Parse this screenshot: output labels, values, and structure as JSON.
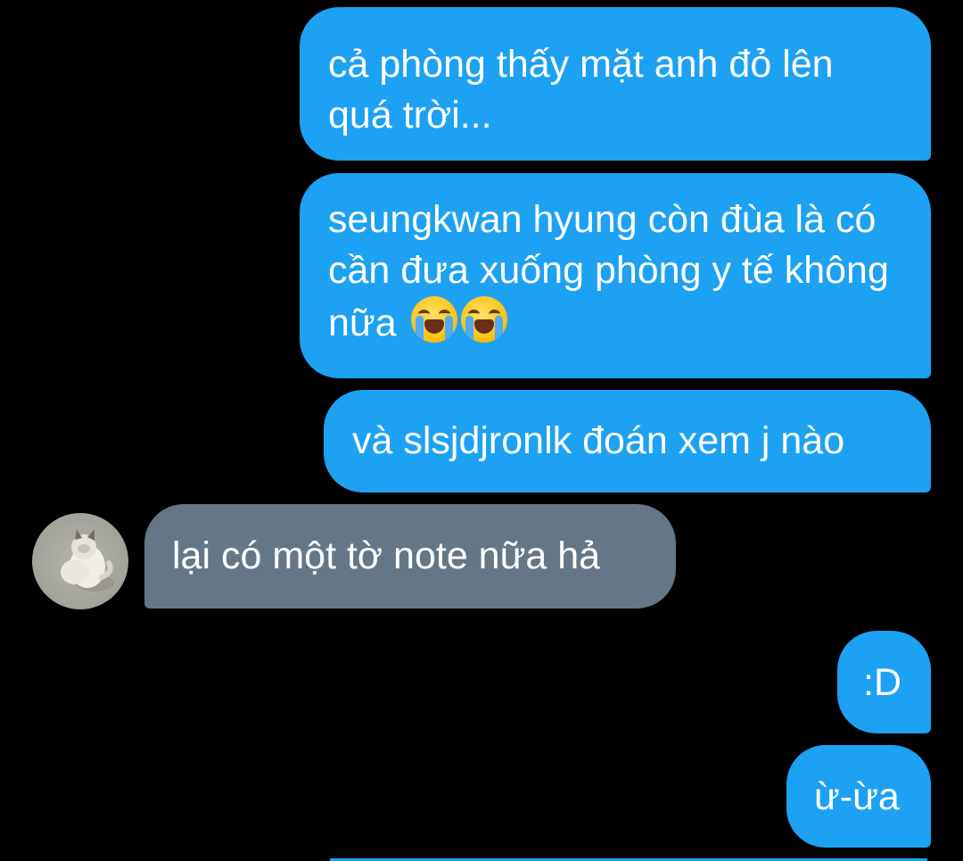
{
  "conversation": {
    "messages": [
      {
        "direction": "sent",
        "text": "cả phòng thấy mặt anh đỏ lên quá trời..."
      },
      {
        "direction": "sent",
        "text": "seungkwan hyung còn đùa là có cần đưa xuống phòng y tế không nữa",
        "trailing_emoji": [
          "loudly-crying-face-icon",
          "loudly-crying-face-icon"
        ]
      },
      {
        "direction": "sent",
        "text": "và slsjdjronlk đoán xem j nào"
      },
      {
        "direction": "received",
        "text": "lại có một tờ note nữa hả",
        "avatar": "cat-avatar-icon"
      },
      {
        "direction": "sent",
        "text": ":D"
      },
      {
        "direction": "sent",
        "text": "ừ-ừa"
      }
    ]
  },
  "colors": {
    "background": "#000000",
    "sent_bubble": "#1da1f2",
    "received_bubble": "#657786",
    "text": "#ffffff"
  }
}
